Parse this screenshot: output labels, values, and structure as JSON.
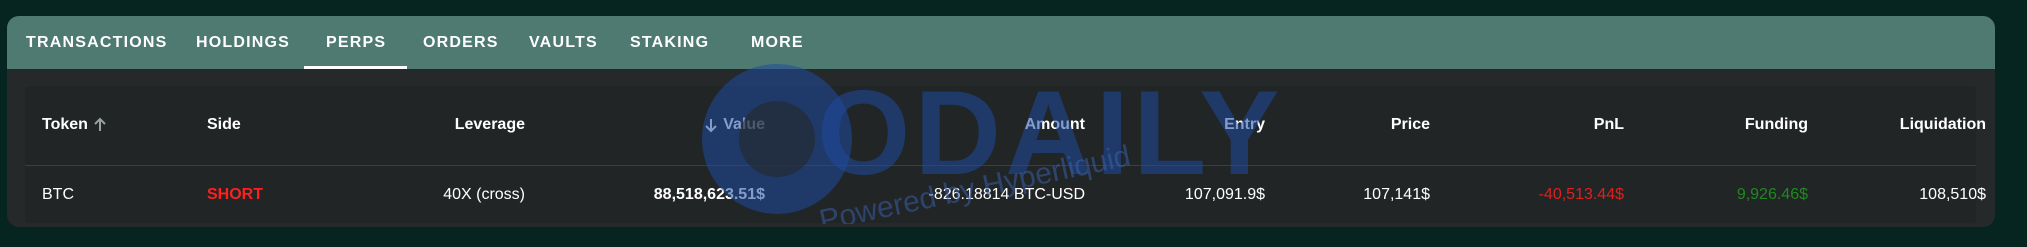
{
  "tabs": [
    {
      "label": "TRANSACTIONS"
    },
    {
      "label": "HOLDINGS"
    },
    {
      "label": "PERPS"
    },
    {
      "label": "ORDERS"
    },
    {
      "label": "VAULTS"
    },
    {
      "label": "STAKING"
    },
    {
      "label": "MORE"
    }
  ],
  "active_tab": "PERPS",
  "table": {
    "headers": {
      "token": "Token",
      "side": "Side",
      "leverage": "Leverage",
      "value": "Value",
      "amount": "Amount",
      "entry": "Entry",
      "price": "Price",
      "pnl": "PnL",
      "funding": "Funding",
      "liquidation": "Liquidation"
    },
    "rows": [
      {
        "token": "BTC",
        "side": "SHORT",
        "leverage": "40X (cross)",
        "value": "88,518,623.51$",
        "amount": "-826.18814 BTC-USD",
        "entry": "107,091.9$",
        "price": "107,141$",
        "pnl": "-40,513.44$",
        "funding": "9,926.46$",
        "liquidation": "108,510$"
      }
    ]
  },
  "watermark": {
    "brand": "ODAILY",
    "tagline": "Powered by Hyperliquid"
  },
  "colors": {
    "background": "#062420",
    "tab_bar": "#4f7a71",
    "panel": "#25292a",
    "short": "#ff1f1f",
    "negative": "#e0201c",
    "positive": "#1e8a1e"
  }
}
